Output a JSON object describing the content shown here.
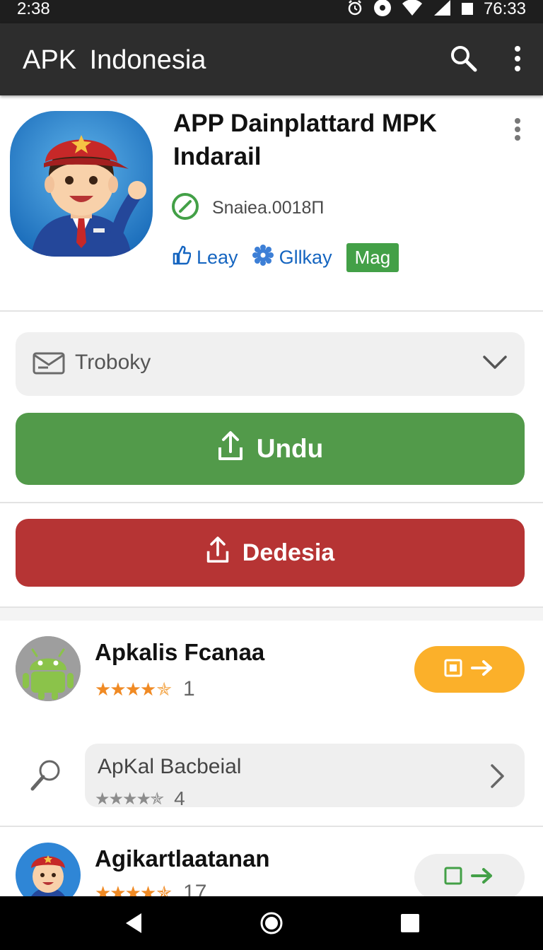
{
  "status_bar": {
    "time": "2:38",
    "clock": "76:33"
  },
  "app_bar": {
    "title": "APK  Indonesia"
  },
  "app": {
    "title": "APP Dainplattard MPK Indarail",
    "version": "Snaiea.0018П",
    "tags": [
      "Leay",
      "Gllkay"
    ],
    "badge": "Mag"
  },
  "dropdown": {
    "label": "Troboky"
  },
  "buttons": {
    "download": "Undu",
    "secondary": "Dedesia"
  },
  "related": [
    {
      "name": "Apkalis Fcanaa",
      "count": "1",
      "rating": 4.5
    },
    {
      "name": "ApKal Bacbeial",
      "count": "4",
      "rating": 4.5
    },
    {
      "name": "Аgikartlaatanan",
      "count": "17",
      "rating": 4.5
    }
  ],
  "colors": {
    "app_bar": "#2d2d2d",
    "download": "#529a4a",
    "secondary": "#b63434",
    "badge": "#43a047",
    "link": "#1565c0",
    "star": "#f08a24",
    "action_orange": "#fbb02a"
  }
}
